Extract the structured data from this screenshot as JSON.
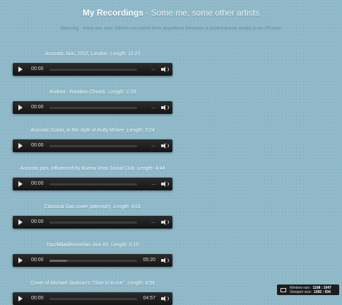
{
  "header": {
    "title_bold": "My Recordings",
    "title_rest": " - Some me, some other artists",
    "warning": "Warning - most are raw! Others recorded from anywhere between a professional studio to an iPhone!"
  },
  "tracks": [
    {
      "title": "Acoustic Jam, 2012, London",
      "length": "Length: 11:23",
      "time": "00:00",
      "duration": "...",
      "progress": 0
    },
    {
      "title": "Andrea - Random Chords",
      "length": "Length: 1:33",
      "time": "00:00",
      "duration": "...",
      "progress": 0
    },
    {
      "title": "Acoustic Guitar, in the style of Andy Mckee",
      "length": "Length: 3:24",
      "time": "00:00",
      "duration": "...",
      "progress": 0
    },
    {
      "title": "Acoustic jam, influenced by Buena Vista Social Club",
      "length": "Length: 4:44",
      "time": "00:00",
      "duration": "...",
      "progress": 0
    },
    {
      "title": "Classical Gas cover (attempt!)",
      "length": "Length: 4:01",
      "time": "00:00",
      "duration": "...",
      "progress": 0
    },
    {
      "title": "Daz/Milad/Kevin/Ian Jam #3",
      "length": "Length: 5:19",
      "time": "00:00",
      "duration": "05:20",
      "progress": 0.2
    },
    {
      "title": "Cover of Michael Jackson's \"Give in to me\"",
      "length": "Length: 4:56",
      "time": "00:00",
      "duration": "04:57",
      "progress": 0
    }
  ],
  "viewport": {
    "window_label": "Window size:",
    "window_value": "1108 : 1047",
    "viewport_label": "Viewport size:",
    "viewport_value": "1092 : 934"
  }
}
